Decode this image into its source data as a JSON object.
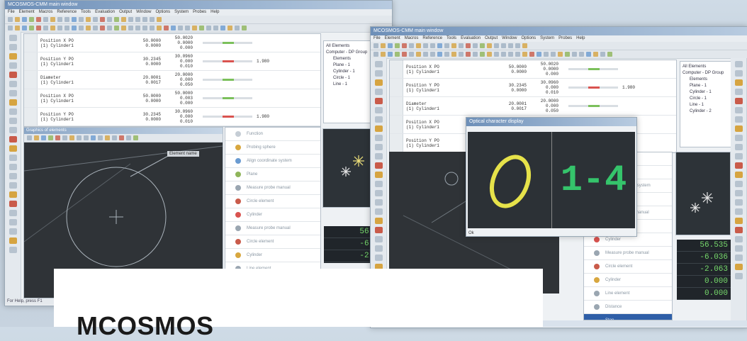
{
  "win1": {
    "title": "MCOSMOS-CMM main window",
    "menus": [
      "File",
      "Element",
      "Macros",
      "Reference",
      "Tools",
      "Evaluation",
      "Output",
      "Window",
      "Options",
      "System",
      "Probes",
      "Help"
    ],
    "results": [
      {
        "name": "Position X PO\n(1) Cylinder1",
        "nom": "50.0000\n0.0000",
        "act": "50.0020\n0.0000\n0.000",
        "bar": "#7bc05b",
        "dev": ""
      },
      {
        "name": "Position Y PO\n(1) Cylinder1",
        "nom": "30.2345\n0.0000",
        "act": "30.0960\n0.000\n0.010",
        "bar": "#d9534f",
        "dev": "1.980"
      },
      {
        "name": "Diameter\n(1) Cylinder1",
        "nom": "20.0001\n0.0017",
        "act": "20.0000\n0.000\n0.050",
        "bar": "#7bc05b",
        "dev": ""
      },
      {
        "name": "Position X PO\n(1) Cylinder1",
        "nom": "50.0000\n0.0000",
        "act": "50.0000\n0.003\n0.000",
        "bar": "#7bc05b",
        "dev": ""
      },
      {
        "name": "Position Y PO\n(1) Cylinder1",
        "nom": "30.2345\n0.0000",
        "act": "30.0960\n0.000\n0.010",
        "bar": "#d9534f",
        "dev": "1.980"
      }
    ],
    "tree": [
      "All Elements",
      "Computer - DP Group",
      "Elements",
      "Plane - 1",
      "Cylinder - 1",
      "Circle - 1",
      "Line - 1"
    ],
    "graphics_title": "Graphics of elements",
    "element_label": "Element name",
    "steps": [
      {
        "label": "Function",
        "icon": "#c5cdd5"
      },
      {
        "label": "Probing sphere",
        "icon": "#d8a73f"
      },
      {
        "label": "Align coordinate system",
        "icon": "#6a9bd1"
      },
      {
        "label": "Plane",
        "icon": "#8fb55a"
      },
      {
        "label": "Measure probe manual",
        "icon": "#9aa6b1"
      },
      {
        "label": "Circle element",
        "icon": "#c95b4a"
      },
      {
        "label": "Cylinder",
        "icon": "#d9534f"
      },
      {
        "label": "Measure probe manual",
        "icon": "#9aa6b1"
      },
      {
        "label": "Circle element",
        "icon": "#c95b4a"
      },
      {
        "label": "Cylinder",
        "icon": "#d8a73f"
      },
      {
        "label": "Line element",
        "icon": "#9aa6b1"
      },
      {
        "label": "Distance",
        "icon": "#9aa6b1"
      },
      {
        "label": "Stop",
        "icon": "#2f5fa8"
      }
    ],
    "status": "For Help, press F1"
  },
  "win2": {
    "title": "MCOSMOS-CMM main window",
    "menus": [
      "File",
      "Element",
      "Macros",
      "Reference",
      "Tools",
      "Evaluation",
      "Output",
      "Window",
      "Options",
      "System",
      "Probes",
      "Help"
    ],
    "tree": [
      "All Elements",
      "Computer - DP Group",
      "Elements",
      "Plane - 1",
      "Cylinder - 1",
      "Circle - 1",
      "Line - 1",
      "Cylinder - 2"
    ],
    "dialog_title": "Optical character display",
    "dialog_text": "1-4",
    "dialog_status": "Ok"
  },
  "readout1": [
    "56.535",
    "-6.036",
    "-2.063"
  ],
  "readout2": [
    "56.535",
    "-6.036",
    "-2.063",
    "0.000",
    "0.000"
  ],
  "caption": {
    "title": "MCOSMOS"
  }
}
